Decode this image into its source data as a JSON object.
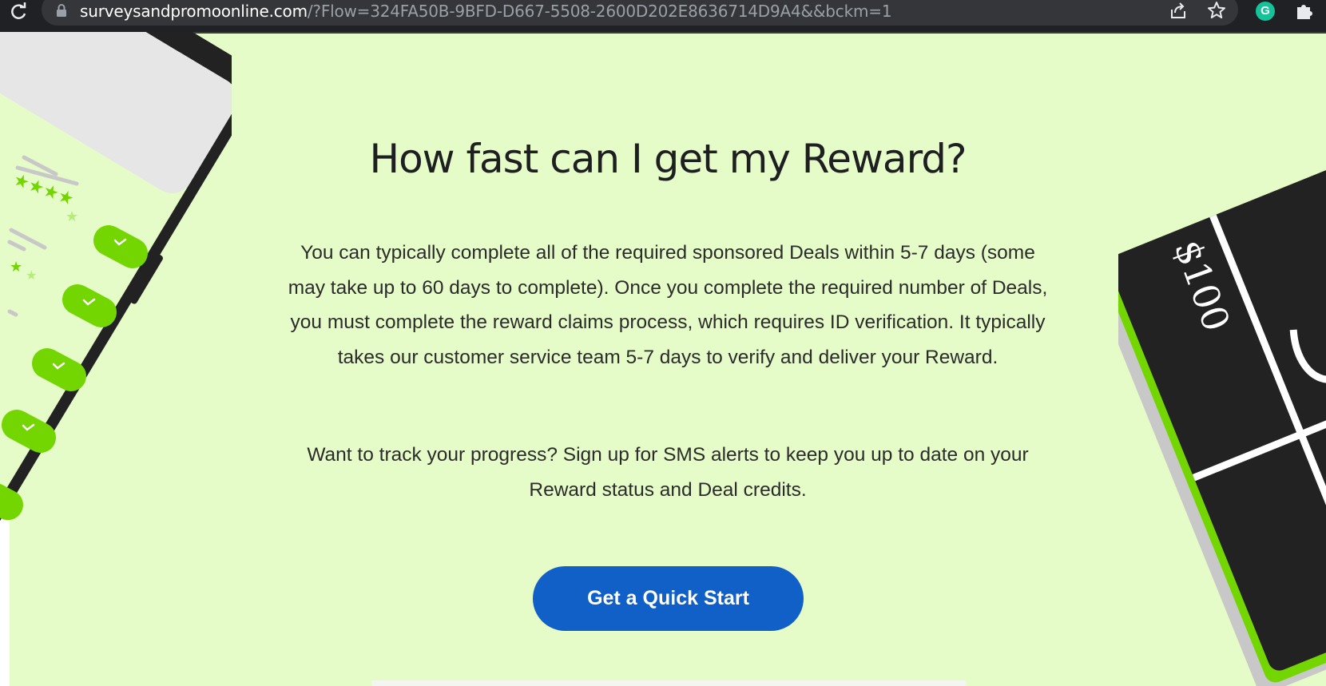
{
  "browser": {
    "url_host": "surveysandpromoonline.com",
    "url_path": "/?Flow=324FA50B-9BFD-D667-5508-2600D202E8636714D9A4&&bckm=1",
    "icons": [
      "reload-icon",
      "lock-icon",
      "share-icon",
      "star-icon",
      "grammarly-icon",
      "extensions-icon"
    ],
    "grammarly_letter": "G"
  },
  "main": {
    "heading": "How fast can I get my Reward?",
    "paragraph1": "You can typically complete all of the required sponsored Deals within 5-7 days (some may take up to 60 days to complete). Once you complete the required number of Deals, you must complete the reward claims process, which requires ID verification. It typically takes our customer service team 5-7 days to verify and deliver your Reward.",
    "paragraph2": "Want to track your progress? Sign up for SMS alerts to keep you up to date on your Reward status and Deal credits.",
    "cta_label": "Get a Quick Start"
  },
  "illustrations": {
    "gift_card_amount": "$100"
  },
  "colors": {
    "background": "#e6fcc8",
    "cta": "#1160c8",
    "accent_green": "#74d600",
    "dark": "#222222"
  }
}
